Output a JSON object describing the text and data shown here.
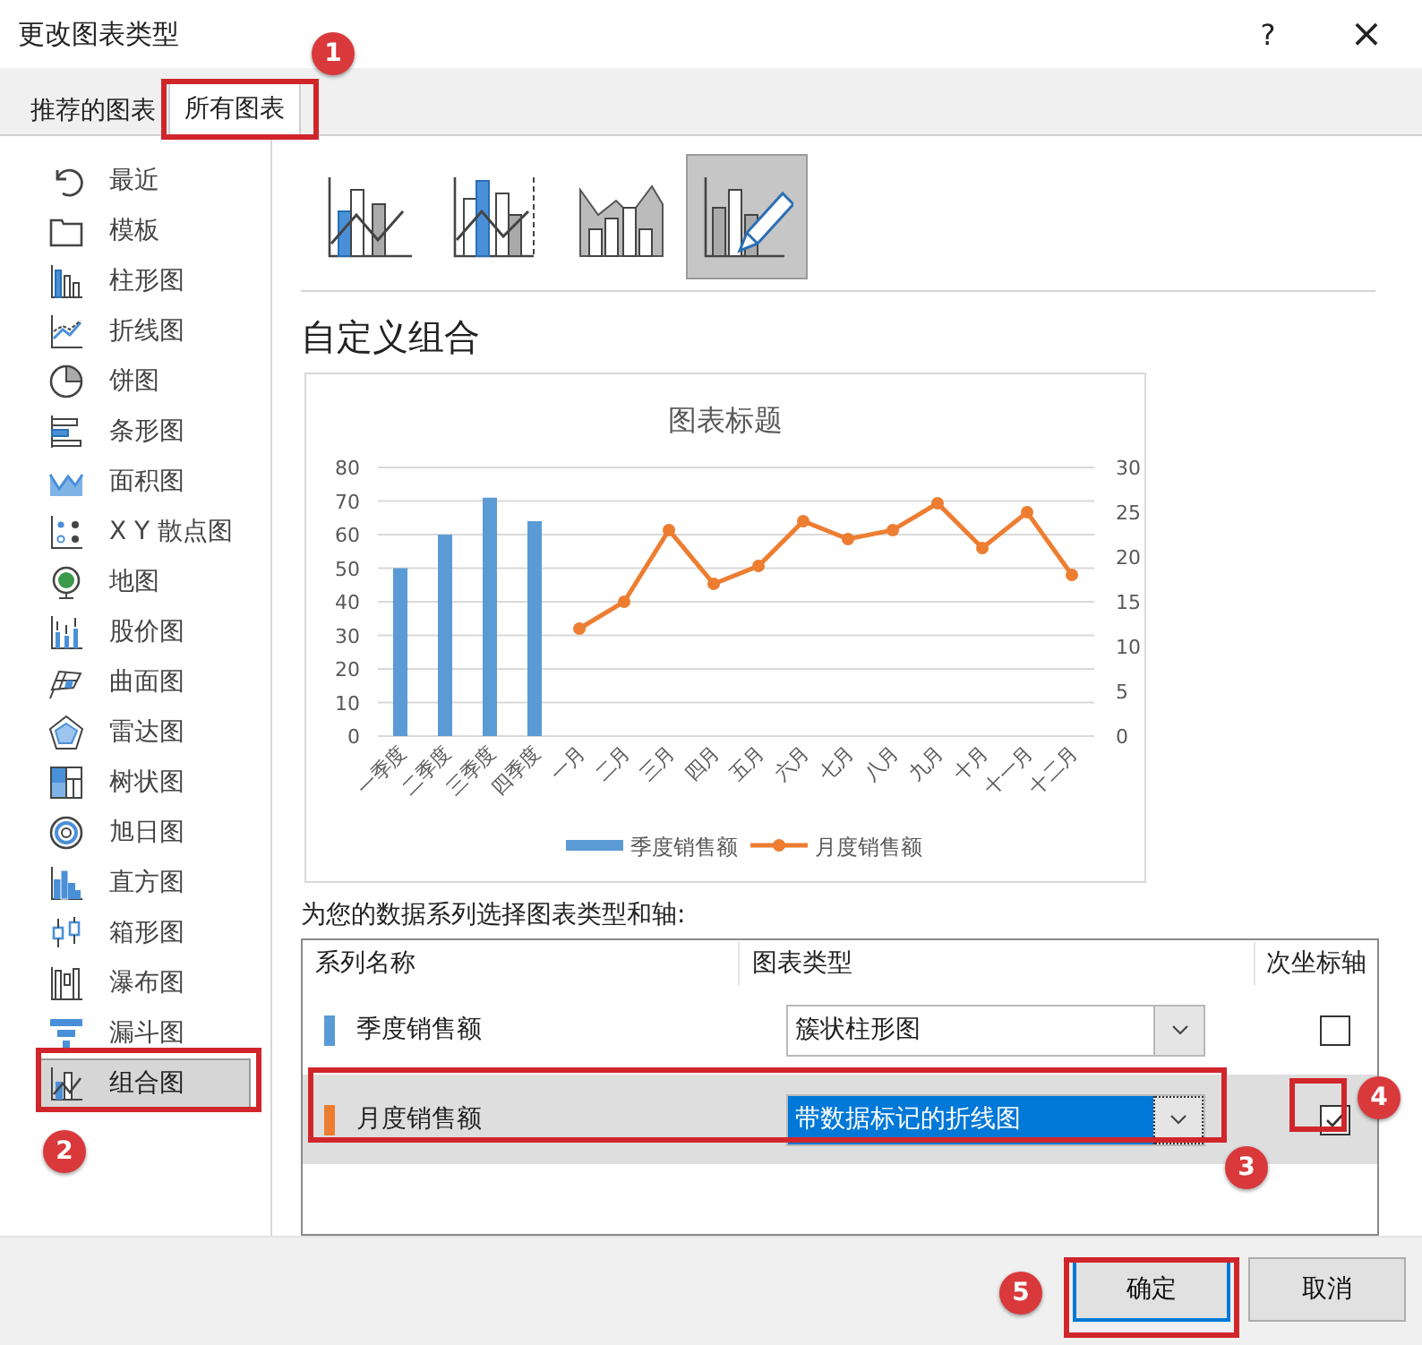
{
  "window": {
    "title": "更改图表类型",
    "help_button": "?",
    "close_button": "×"
  },
  "tabs": [
    {
      "label": "推荐的图表",
      "selected": false
    },
    {
      "label": "所有图表",
      "selected": true
    }
  ],
  "chart_categories": [
    {
      "label": "最近",
      "selected": false
    },
    {
      "label": "模板",
      "selected": false
    },
    {
      "label": "柱形图",
      "selected": false
    },
    {
      "label": "折线图",
      "selected": false
    },
    {
      "label": "饼图",
      "selected": false
    },
    {
      "label": "条形图",
      "selected": false
    },
    {
      "label": "面积图",
      "selected": false
    },
    {
      "label": "X Y 散点图",
      "selected": false
    },
    {
      "label": "地图",
      "selected": false
    },
    {
      "label": "股价图",
      "selected": false
    },
    {
      "label": "曲面图",
      "selected": false
    },
    {
      "label": "雷达图",
      "selected": false
    },
    {
      "label": "树状图",
      "selected": false
    },
    {
      "label": "旭日图",
      "selected": false
    },
    {
      "label": "直方图",
      "selected": false
    },
    {
      "label": "箱形图",
      "selected": false
    },
    {
      "label": "瀑布图",
      "selected": false
    },
    {
      "label": "漏斗图",
      "selected": false
    },
    {
      "label": "组合图",
      "selected": true
    }
  ],
  "subtypes": [
    {
      "selected": false
    },
    {
      "selected": false
    },
    {
      "selected": false
    },
    {
      "selected": true
    }
  ],
  "heading": "自定义组合",
  "preview": {
    "chart_data": {
      "type": "bar",
      "title": "图表标题",
      "categories": [
        "一季度",
        "二季度",
        "三季度",
        "四季度",
        "一月",
        "二月",
        "三月",
        "四月",
        "五月",
        "六月",
        "七月",
        "八月",
        "九月",
        "十月",
        "十一月",
        "十二月"
      ],
      "series": [
        {
          "name": "季度销售额",
          "color": "#5b9bd5",
          "values": [
            50,
            60,
            71,
            64,
            null,
            null,
            null,
            null,
            null,
            null,
            null,
            null,
            null,
            null,
            null,
            null
          ]
        },
        {
          "name": "月度销售额",
          "type": "line",
          "axis": "y2",
          "marker": "circle",
          "color": "#ed7d31",
          "values": [
            null,
            null,
            null,
            null,
            12,
            15,
            23,
            17,
            19,
            24,
            22,
            23,
            26,
            21,
            25,
            18
          ]
        }
      ],
      "ylim": [
        0,
        80
      ],
      "yticks": [
        0,
        10,
        20,
        30,
        40,
        50,
        60,
        70,
        80
      ],
      "grid": true,
      "legend": "bottom",
      "y2lim": [
        0,
        30
      ],
      "y2ticks": [
        0,
        5,
        10,
        15,
        20,
        25,
        30
      ]
    }
  },
  "series_prompt": "为您的数据系列选择图表类型和轴:",
  "series_table": {
    "columns": [
      "系列名称",
      "图表类型",
      "次坐标轴"
    ],
    "rows": [
      {
        "name": "季度销售额",
        "color": "#5b9bd5",
        "chart_type": "簇状柱形图",
        "secondary_axis": false,
        "selected": false
      },
      {
        "name": "月度销售额",
        "color": "#ed7d31",
        "chart_type": "带数据标记的折线图",
        "secondary_axis": true,
        "selected": true
      }
    ]
  },
  "buttons": [
    {
      "label": "确定",
      "default": true
    },
    {
      "label": "取消",
      "default": false
    }
  ],
  "annotations": [
    {
      "number": "1"
    },
    {
      "number": "2"
    },
    {
      "number": "3"
    },
    {
      "number": "4"
    },
    {
      "number": "5"
    }
  ]
}
